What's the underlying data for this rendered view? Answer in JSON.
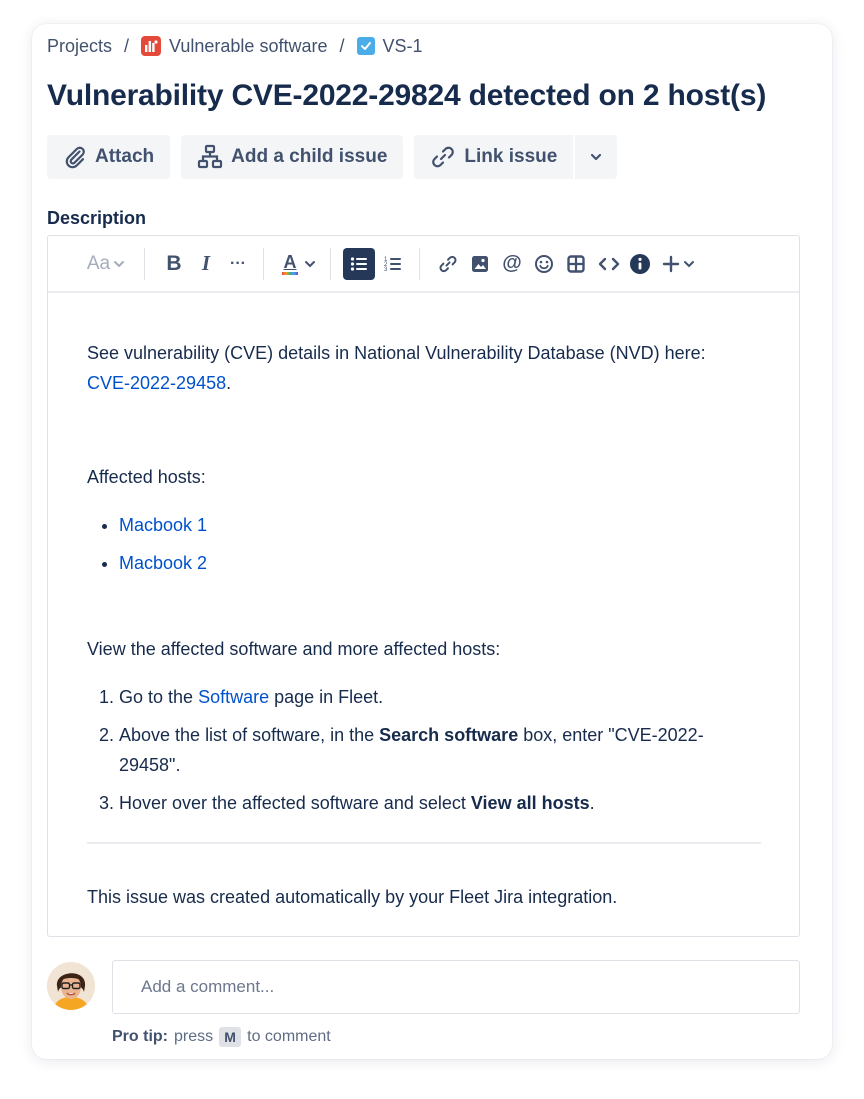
{
  "breadcrumb": {
    "projects": "Projects",
    "separator": "/",
    "project": "Vulnerable software",
    "issue_key": "VS-1"
  },
  "title": "Vulnerability CVE-2022-29824 detected on 2 host(s)",
  "actions": {
    "attach": "Attach",
    "add_child": "Add a child issue",
    "link_issue": "Link issue"
  },
  "description": {
    "label": "Description",
    "toolbar": {
      "text_style": "Aa",
      "bold": "B",
      "italic": "I",
      "more": "···",
      "text_color": "A",
      "mention": "@"
    },
    "intro_text": "See vulnerability (CVE) details in National Vulnerability Database (NVD) here:",
    "cve_link": "CVE-2022-29458",
    "cve_link_suffix": ".",
    "affected_hosts_label": "Affected hosts:",
    "hosts": [
      "Macbook 1",
      "Macbook 2"
    ],
    "view_text": "View the affected software and more affected hosts:",
    "step1_pre": "Go to the ",
    "step1_link": "Software",
    "step1_post": " page in Fleet.",
    "step2_pre": "Above the list of software, in the ",
    "step2_bold": "Search software",
    "step2_post": " box, enter \"CVE-2022-29458\".",
    "step3_pre": "Hover over the affected software and select ",
    "step3_bold": "View all hosts",
    "step3_post": ".",
    "footer": "This issue was created automatically by your Fleet Jira integration."
  },
  "comment": {
    "placeholder": "Add a comment...",
    "protip_label": "Pro tip:",
    "protip_press": "press",
    "protip_key": "M",
    "protip_rest": "to comment"
  },
  "colors": {
    "link": "#0052cc",
    "text": "#172b4d",
    "project_icon": "#e5493a",
    "task_icon": "#4bade8",
    "button_bg": "#f4f5f7"
  },
  "icons": {
    "project": "project-icon",
    "task": "task-checkbox-icon",
    "attach": "paperclip-icon",
    "child": "hierarchy-icon",
    "link": "link-icon"
  }
}
